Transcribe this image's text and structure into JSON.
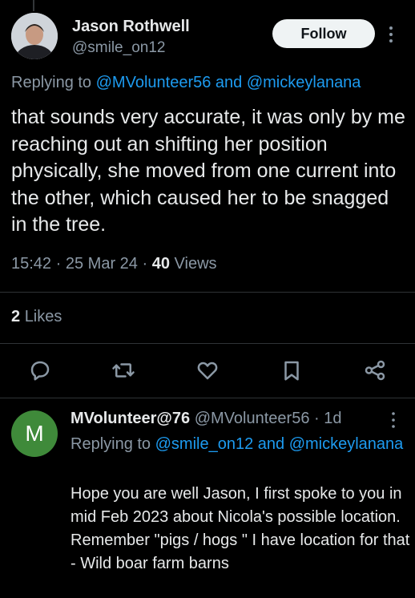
{
  "tweet": {
    "author_name": "Jason Rothwell",
    "author_handle": "@smile_on12",
    "follow_label": "Follow",
    "replying_prefix": "Replying to ",
    "replying_user1": "@MVolunteer56",
    "replying_and": " and ",
    "replying_user2": "@mickeylanana",
    "text": "that sounds very accurate, it was only by me reaching out an shifting her position physically, she moved from one current into the other, which caused her to be snagged in the tree.",
    "time": "15:42",
    "date": "25 Mar 24",
    "views_count": "40",
    "views_label": "Views",
    "likes_count": "2",
    "likes_label": "Likes"
  },
  "actions": [
    "reply-icon",
    "repost-icon",
    "like-icon",
    "bookmark-icon",
    "share-icon"
  ],
  "reply": {
    "avatar_letter": "M",
    "avatar_color": "#3f8a3a",
    "author_name": "MVolunteer@76",
    "author_handle": "@MVolunteer56",
    "age": "1d",
    "replying_prefix": "Replying to ",
    "replying_user1": "@smile_on12",
    "replying_and": " and ",
    "replying_user2": "@mickeylanana",
    "text": "Hope you are well Jason, I first spoke to you in mid Feb 2023 about Nicola's possible location. Remember \"pigs / hogs \" I have location for that -  Wild boar farm barns"
  },
  "colors": {
    "background": "#000000",
    "text": "#e7e9ea",
    "muted": "#8b98a5",
    "link": "#1d9bf0",
    "divider": "#2f3336"
  }
}
